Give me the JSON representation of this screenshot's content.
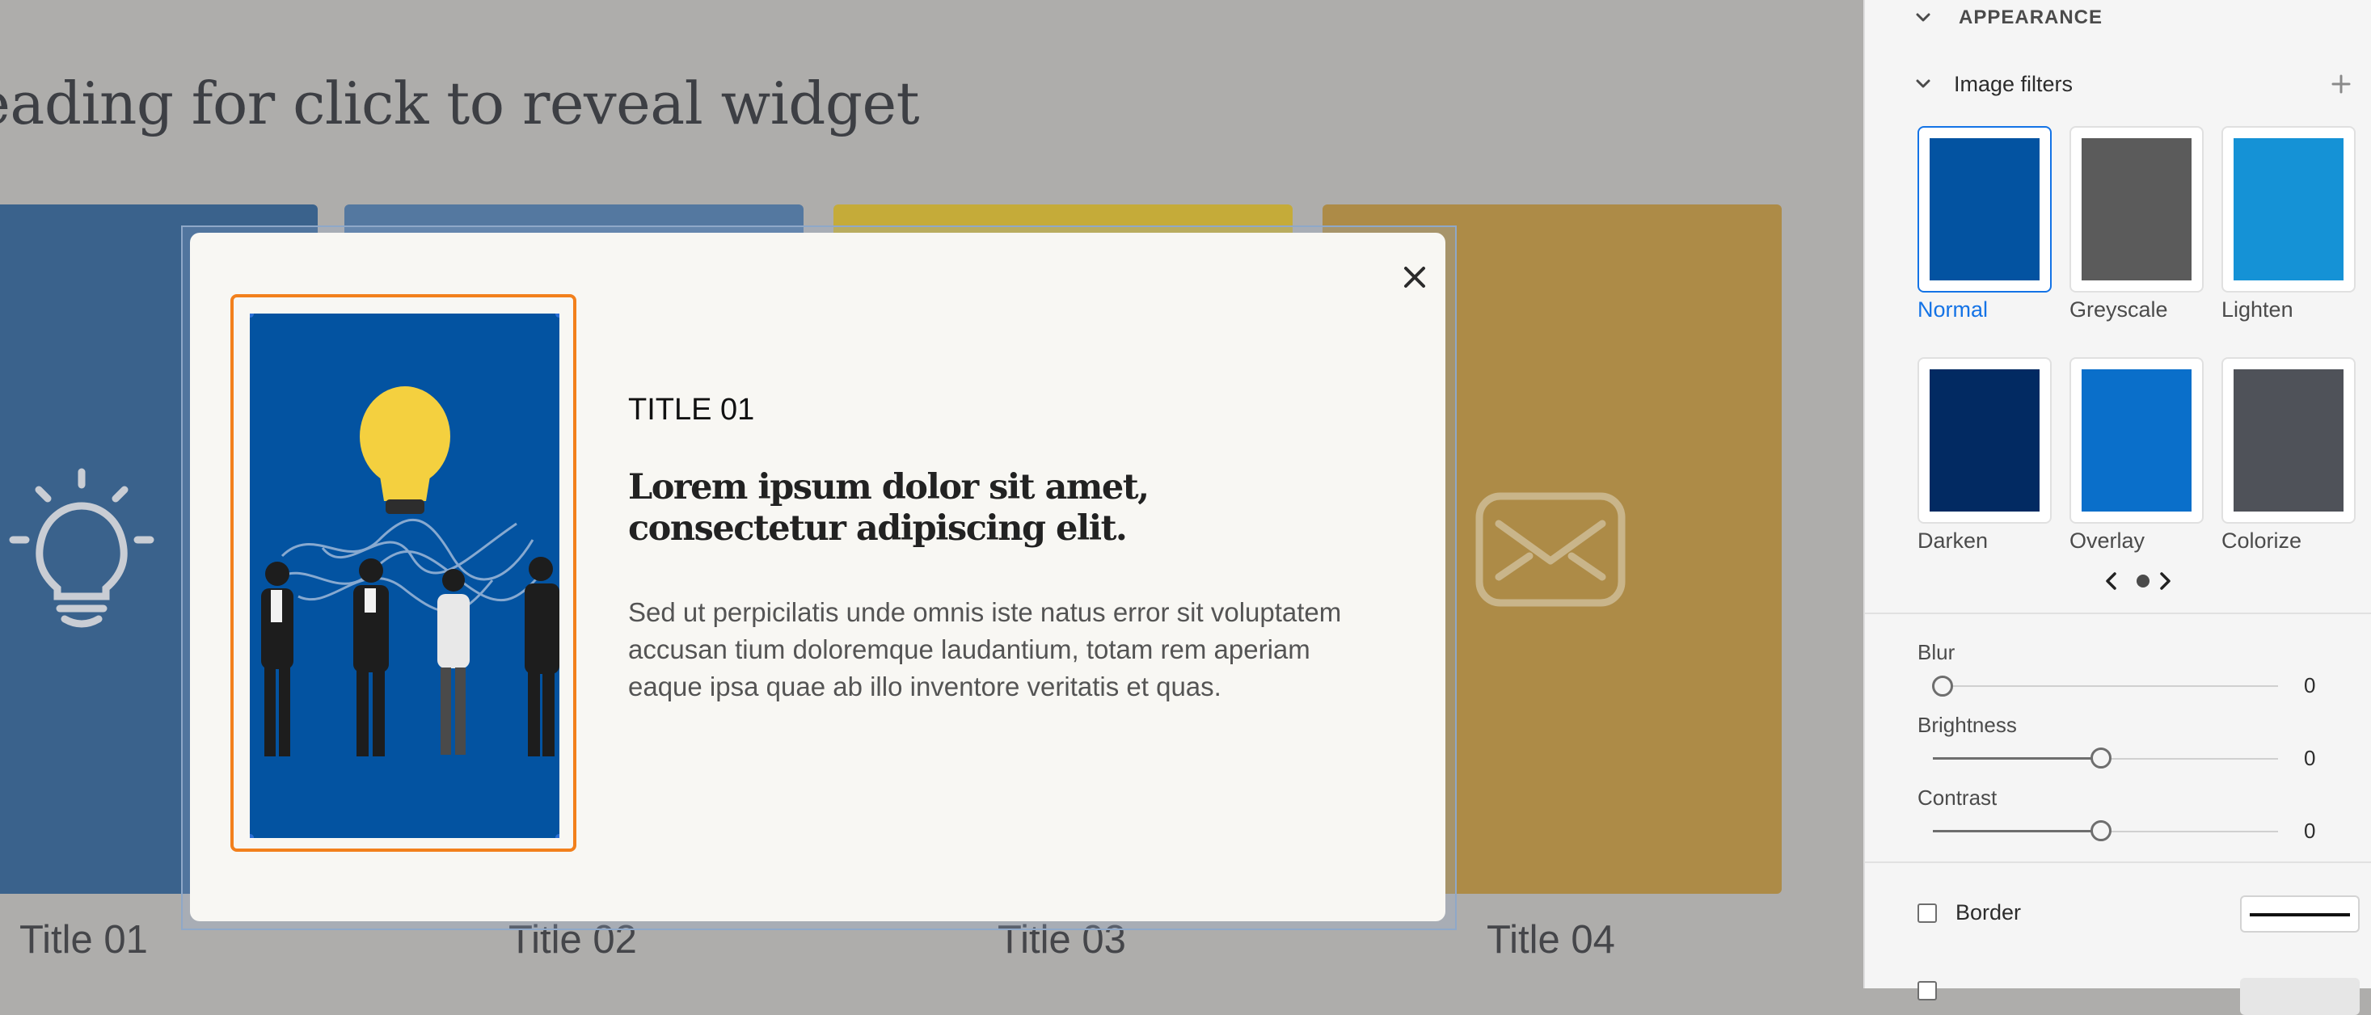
{
  "canvas": {
    "heading": "Heading for click to reveal widget",
    "cards": [
      {
        "label": "Title 01",
        "color": "#3a628c"
      },
      {
        "label": "Title 02",
        "color": "#5478a0"
      },
      {
        "label": "Title 03",
        "color": "#c5ab39"
      },
      {
        "label": "Title 04",
        "color": "#ad8b47"
      }
    ]
  },
  "modal": {
    "kicker": "TITLE 01",
    "heading": "Lorem ipsum dolor sit amet, consectetur adipiscing elit.",
    "body": "Sed ut perpicilatis unde omnis iste natus error sit voluptatem accusan tium doloremque laudantium, totam rem aperiam eaque ipsa quae ab illo inventore veritatis et quas.",
    "close_icon": "close-icon",
    "image_bg": "#0353a1"
  },
  "panel": {
    "section_title": "APPEARANCE",
    "filters_title": "Image filters",
    "add_icon": "plus-icon",
    "filters": [
      {
        "label": "Normal",
        "bg": "#0353a1",
        "selected": true
      },
      {
        "label": "Greyscale",
        "bg": "#5b5b5b",
        "selected": false
      },
      {
        "label": "Lighten",
        "bg": "#1592d6",
        "selected": false
      },
      {
        "label": "Darken",
        "bg": "#022a62",
        "selected": false
      },
      {
        "label": "Overlay",
        "bg": "#0a6fca",
        "selected": false
      },
      {
        "label": "Colorize",
        "bg": "#4f5259",
        "selected": false
      }
    ],
    "pagination": {
      "prev_icon": "chevron-left-icon",
      "next_icon": "chevron-right-icon"
    },
    "sliders": [
      {
        "label": "Blur",
        "value": "0",
        "level": 0
      },
      {
        "label": "Brightness",
        "value": "0",
        "level": 0.5
      },
      {
        "label": "Contrast",
        "value": "0",
        "level": 0.5
      }
    ],
    "border": {
      "label": "Border",
      "checked": false
    }
  }
}
